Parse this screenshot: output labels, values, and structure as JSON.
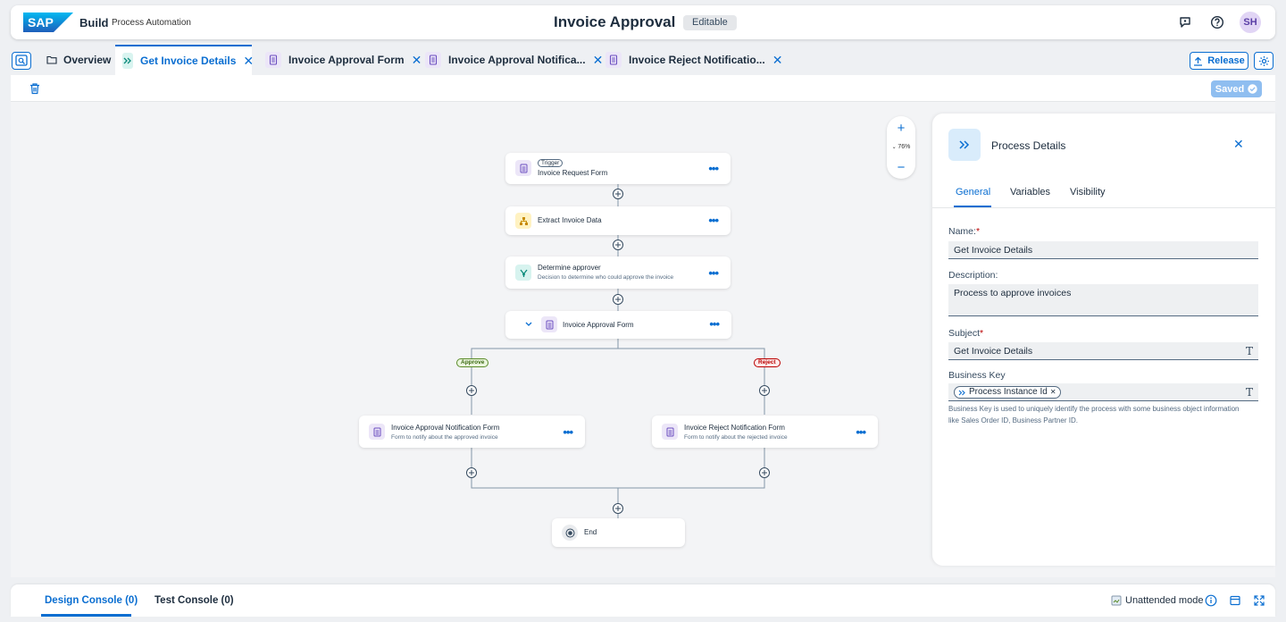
{
  "shell": {
    "logo_text": "SAP",
    "build_label": "Build",
    "subtitle": "Process Automation",
    "title": "Invoice Approval",
    "status_badge": "Editable",
    "avatar_initials": "SH",
    "icons": [
      "feedback-icon",
      "help-icon"
    ]
  },
  "tabs": [
    {
      "label": "Overview",
      "icon": "folder-icon",
      "active": false,
      "closable": false
    },
    {
      "label": "Get Invoice Details",
      "icon": "process-icon",
      "active": true,
      "closable": true
    },
    {
      "label": "Invoice Approval Form",
      "icon": "form-icon",
      "active": false,
      "closable": true
    },
    {
      "label": "Invoice Approval Notifica...",
      "icon": "form-icon",
      "active": false,
      "closable": true
    },
    {
      "label": "Invoice Reject Notificatio...",
      "icon": "form-icon",
      "active": false,
      "closable": true
    }
  ],
  "tab_close_glyph": "✕",
  "release_label": "Release",
  "saved_label": "Saved",
  "zoom": {
    "plus": "+",
    "minus": "−",
    "level": "76%"
  },
  "flow": {
    "trigger": {
      "chip": "Trigger",
      "title": "Invoice Request Form",
      "icon": "form-icon"
    },
    "extract": {
      "title": "Extract Invoice Data",
      "icon": "automation-icon"
    },
    "decision": {
      "title": "Determine approver",
      "desc": "Decision to determine who could approve the invoice",
      "icon": "decision-icon"
    },
    "approval_form": {
      "title": "Invoice Approval Form",
      "icon": "form-icon"
    },
    "branches": {
      "approve": "Approve",
      "reject": "Reject"
    },
    "approve_notification": {
      "title": "Invoice Approval Notification Form",
      "desc": "Form to notify about the approved invoice",
      "icon": "form-icon"
    },
    "reject_notification": {
      "title": "Invoice Reject Notification Form",
      "desc": "Form to notify about the rejected invoice",
      "icon": "form-icon"
    },
    "end": {
      "title": "End",
      "icon": "end-icon"
    },
    "more_glyph": "•••"
  },
  "panel": {
    "title": "Process Details",
    "tabs": [
      "General",
      "Variables",
      "Visibility"
    ],
    "active_tab": "General",
    "name_label": "Name:",
    "name_value": "Get Invoice Details",
    "description_label": "Description:",
    "description_value": "Process to approve invoices",
    "subject_label": "Subject",
    "subject_value": "Get Invoice Details",
    "business_key_label": "Business Key",
    "business_key_token": "Process Instance Id",
    "business_key_hint": "Business Key is used to uniquely identify the process with some business object information like Sales Order ID, Business Partner ID.",
    "required_marker": "*",
    "text_type_glyph": "T"
  },
  "console": {
    "tabs": [
      "Design Console (0)",
      "Test Console (0)"
    ],
    "active_tab": "Design Console (0)",
    "unattended_label": "Unattended mode"
  },
  "colors": {
    "accent": "#0a6ed1",
    "approve": "#5b8c2a",
    "reject": "#bb0000",
    "form_icon_bg": "#ece6f8"
  }
}
